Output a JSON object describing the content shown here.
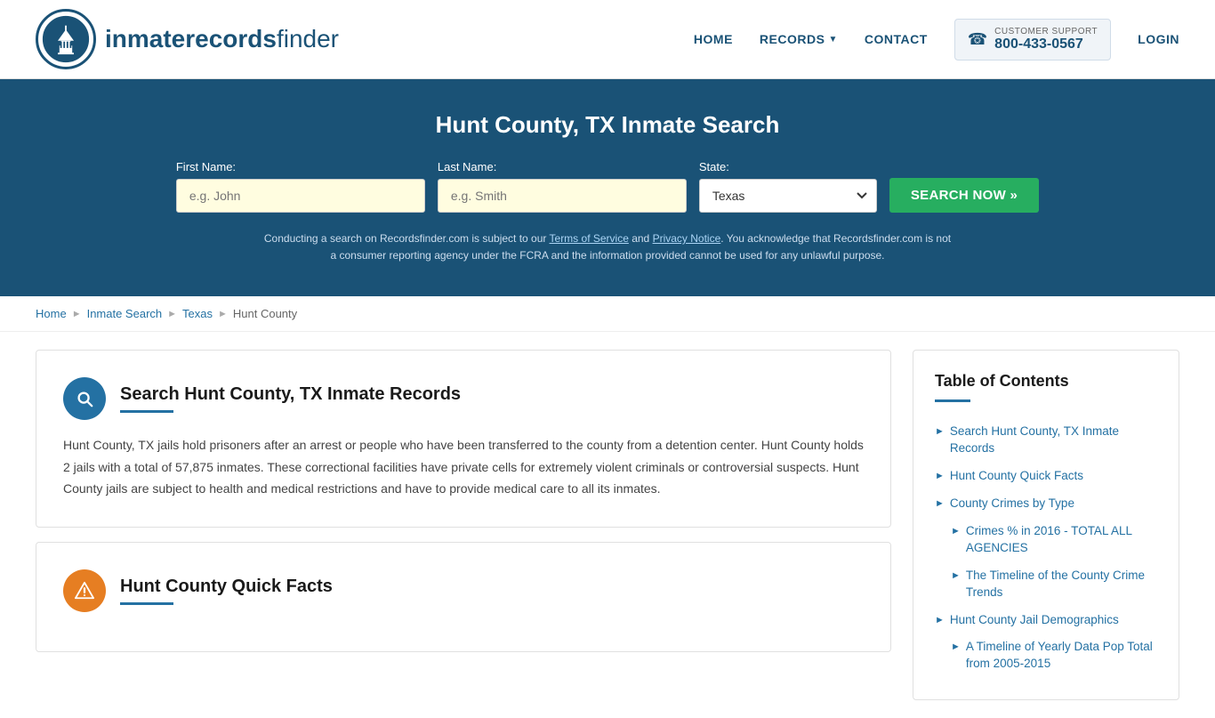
{
  "header": {
    "logo_text_light": "inmaterecords",
    "logo_text_bold": "finder",
    "nav": {
      "home": "HOME",
      "records": "RECORDS",
      "contact": "CONTACT",
      "login": "LOGIN"
    },
    "support": {
      "label": "CUSTOMER SUPPORT",
      "number": "800-433-0567"
    }
  },
  "hero": {
    "title": "Hunt County, TX Inmate Search",
    "fields": {
      "first_name_label": "First Name:",
      "first_name_placeholder": "e.g. John",
      "last_name_label": "Last Name:",
      "last_name_placeholder": "e.g. Smith",
      "state_label": "State:",
      "state_value": "Texas"
    },
    "search_button": "SEARCH NOW »",
    "disclaimer": "Conducting a search on Recordsfinder.com is subject to our Terms of Service and Privacy Notice. You acknowledge that Recordsfinder.com is not a consumer reporting agency under the FCRA and the information provided cannot be used for any unlawful purpose."
  },
  "breadcrumb": {
    "items": [
      "Home",
      "Inmate Search",
      "Texas",
      "Hunt County"
    ]
  },
  "main": {
    "section1": {
      "title": "Search Hunt County, TX Inmate Records",
      "text": "Hunt County, TX jails hold prisoners after an arrest or people who have been transferred to the county from a detention center. Hunt County holds 2 jails with a total of 57,875 inmates. These correctional facilities have private cells for extremely violent criminals or controversial suspects. Hunt County jails are subject to health and medical restrictions and have to provide medical care to all its inmates."
    },
    "section2": {
      "title": "Hunt County Quick Facts"
    }
  },
  "toc": {
    "title": "Table of Contents",
    "items": [
      {
        "label": "Search Hunt County, TX Inmate Records",
        "sub": false
      },
      {
        "label": "Hunt County Quick Facts",
        "sub": false
      },
      {
        "label": "County Crimes by Type",
        "sub": false
      },
      {
        "label": "Crimes % in 2016 - TOTAL ALL AGENCIES",
        "sub": true
      },
      {
        "label": "The Timeline of the County Crime Trends",
        "sub": true
      },
      {
        "label": "Hunt County Jail Demographics",
        "sub": false
      },
      {
        "label": "A Timeline of Yearly Data Pop Total from 2005-2015",
        "sub": true
      }
    ]
  }
}
